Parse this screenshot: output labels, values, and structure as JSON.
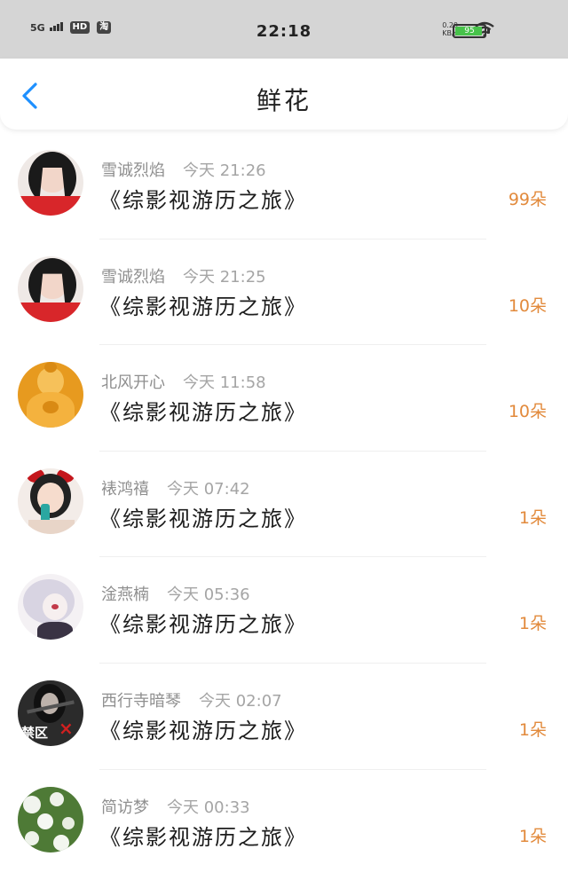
{
  "status_bar": {
    "network": "5G",
    "hd": "HD",
    "taobao": "淘",
    "time": "22:18",
    "speed_value": "0.20",
    "speed_unit": "KB/s",
    "battery_percent": 95,
    "battery_text": "95"
  },
  "header": {
    "title": "鲜花"
  },
  "items": [
    {
      "name": "雪诚烈焰",
      "time": "今天 21:26",
      "book": "《综影视游历之旅》",
      "count": "99朵"
    },
    {
      "name": "雪诚烈焰",
      "time": "今天 21:25",
      "book": "《综影视游历之旅》",
      "count": "10朵"
    },
    {
      "name": "北风开心",
      "time": "今天 11:58",
      "book": "《综影视游历之旅》",
      "count": "10朵"
    },
    {
      "name": "裱鸿禧",
      "time": "今天 07:42",
      "book": "《综影视游历之旅》",
      "count": "1朵"
    },
    {
      "name": "淦燕楠",
      "time": "今天 05:36",
      "book": "《综影视游历之旅》",
      "count": "1朵"
    },
    {
      "name": "西行寺暗琴",
      "time": "今天 02:07",
      "book": "《综影视游历之旅》",
      "count": "1朵",
      "avatar_text": "禁区"
    },
    {
      "name": "简访梦",
      "time": "今天 00:33",
      "book": "《综影视游历之旅》",
      "count": "1朵"
    }
  ],
  "colors": {
    "accent": "#1e90ff",
    "count": "#e28a3c",
    "status_bar": "#d5d5d5"
  }
}
